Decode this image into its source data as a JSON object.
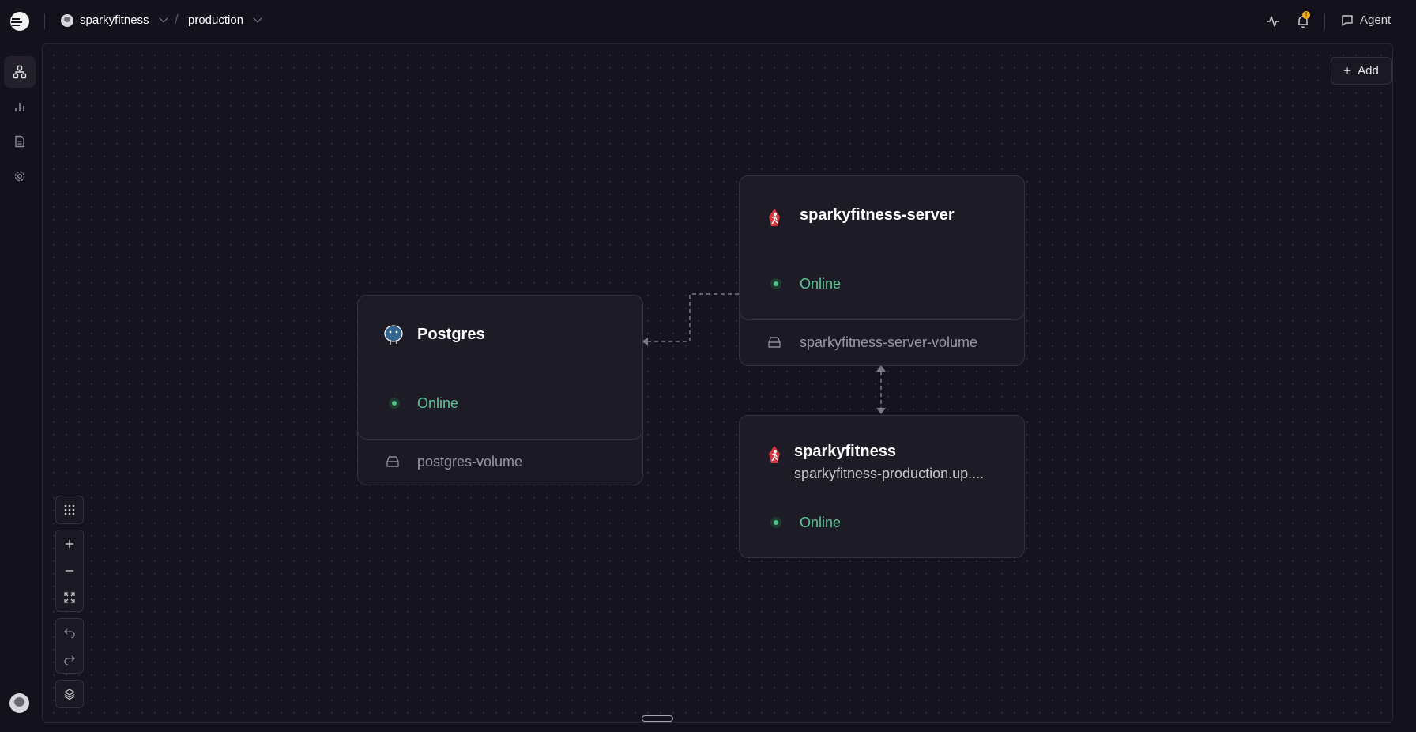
{
  "header": {
    "project_name": "sparkyfitness",
    "environment": "production",
    "agent_label": "Agent",
    "notification_badge": "!"
  },
  "canvas": {
    "add_label": "Add"
  },
  "services": {
    "postgres": {
      "title": "Postgres",
      "status": "Online",
      "volume": "postgres-volume"
    },
    "server": {
      "title": "sparkyfitness-server",
      "status": "Online",
      "volume": "sparkyfitness-server-volume"
    },
    "app": {
      "title": "sparkyfitness",
      "subtitle": "sparkyfitness-production.up....",
      "status": "Online"
    }
  },
  "colors": {
    "background": "#13111c",
    "online": "#5dc496",
    "badge": "#f2b01e"
  }
}
